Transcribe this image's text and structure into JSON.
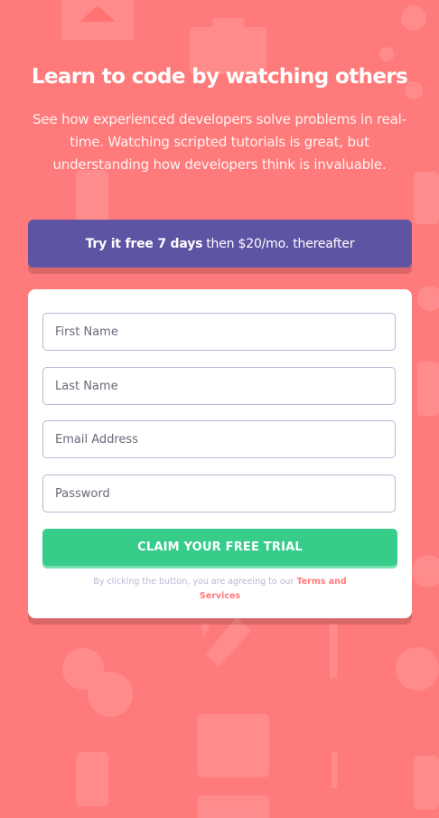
{
  "hero": {
    "title": "Learn to code by watching others",
    "text": "See how experienced developers solve problems in real-time. Watching scripted tutorials is great, but understanding how developers think is invaluable."
  },
  "promo": {
    "bold": "Try it free 7 days",
    "rest": "then $20/mo. thereafter"
  },
  "form": {
    "first_name_placeholder": "First Name",
    "last_name_placeholder": "Last Name",
    "email_placeholder": "Email Address",
    "password_placeholder": "Password",
    "submit_label": "CLAIM YOUR FREE TRIAL",
    "terms_prefix": "By clicking the button, you are agreeing to our",
    "terms_link": "Terms and Services"
  },
  "colors": {
    "background": "#ff7a7a",
    "promo": "#5e54a4",
    "cta": "#38cc8b",
    "field_border": "#b9b6d3"
  },
  "background_icons": [
    "house-icon",
    "toolbox-icon",
    "network-icon",
    "chat-bubble-icon",
    "rocket-icon",
    "calendar-icon",
    "phone-icon",
    "pencil-icon"
  ]
}
